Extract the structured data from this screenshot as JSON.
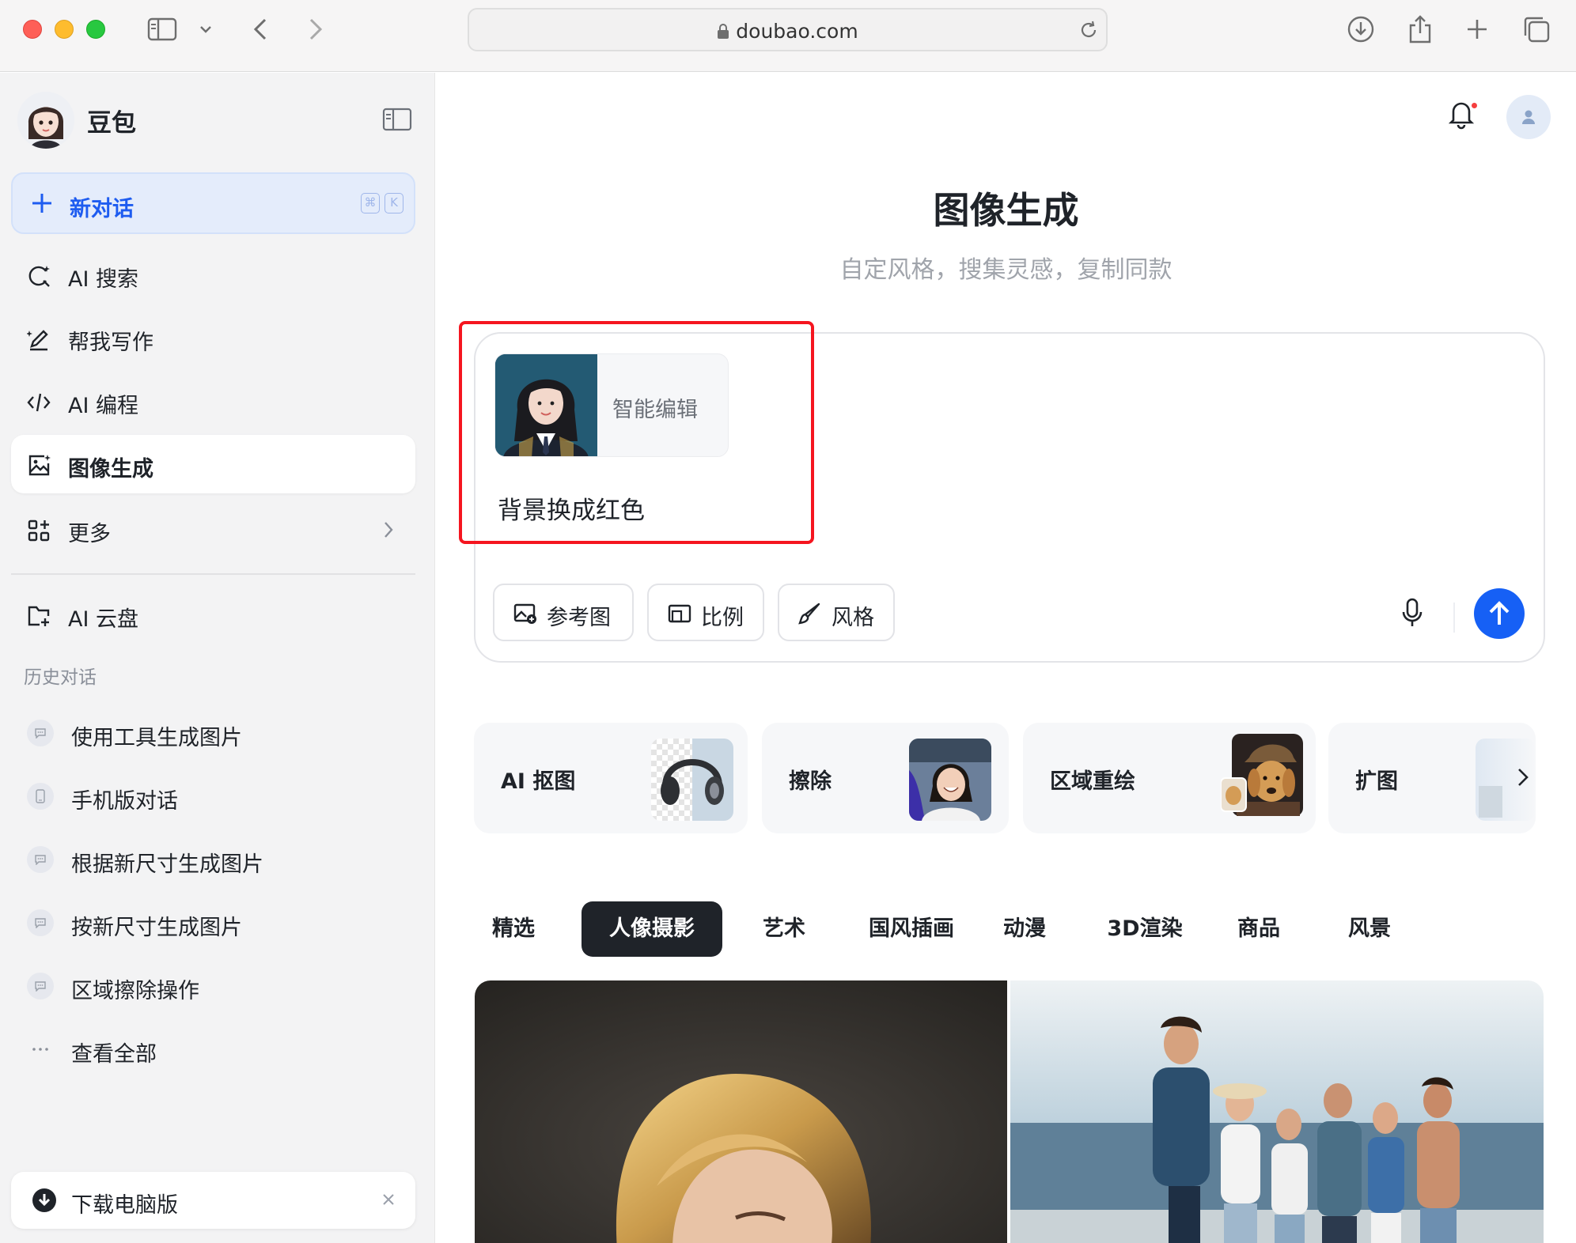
{
  "browser": {
    "url": "doubao.com"
  },
  "sidebar": {
    "app_name": "豆包",
    "new_chat": {
      "label": "新对话",
      "shortcut_cmd": "⌘",
      "shortcut_key": "K"
    },
    "nav": [
      {
        "label": "AI 搜索",
        "icon": "ai-search-icon"
      },
      {
        "label": "帮我写作",
        "icon": "writing-pen-icon"
      },
      {
        "label": "AI 编程",
        "icon": "code-icon"
      },
      {
        "label": "图像生成",
        "icon": "image-gen-icon",
        "active": true
      },
      {
        "label": "更多",
        "icon": "apps-grid-icon"
      }
    ],
    "cloud": {
      "label": "AI 云盘",
      "icon": "cloud-folder-icon"
    },
    "history_title": "历史对话",
    "history": [
      {
        "label": "使用工具生成图片"
      },
      {
        "label": "手机版对话"
      },
      {
        "label": "根据新尺寸生成图片"
      },
      {
        "label": "按新尺寸生成图片"
      },
      {
        "label": "区域擦除操作"
      },
      {
        "label": "查看全部"
      }
    ],
    "download": {
      "label": "下载电脑版"
    }
  },
  "main": {
    "title": "图像生成",
    "subtitle": "自定风格，搜集灵感，复制同款",
    "composer": {
      "reference_label": "智能编辑",
      "prompt": "背景换成红色",
      "tools": [
        {
          "label": "参考图",
          "icon": "reference-image-icon"
        },
        {
          "label": "比例",
          "icon": "ratio-icon"
        },
        {
          "label": "风格",
          "icon": "brush-icon"
        }
      ]
    },
    "features": [
      {
        "label": "AI 抠图"
      },
      {
        "label": "擦除"
      },
      {
        "label": "区域重绘"
      },
      {
        "label": "扩图"
      }
    ],
    "categories": [
      {
        "label": "精选"
      },
      {
        "label": "人像摄影",
        "active": true
      },
      {
        "label": "艺术"
      },
      {
        "label": "国风插画"
      },
      {
        "label": "动漫"
      },
      {
        "label": "3D渲染"
      },
      {
        "label": "商品"
      },
      {
        "label": "风景"
      }
    ]
  },
  "colors": {
    "accent": "#1660f5",
    "highlight_box": "#f5151f",
    "active_tab_bg": "#1f2329"
  }
}
